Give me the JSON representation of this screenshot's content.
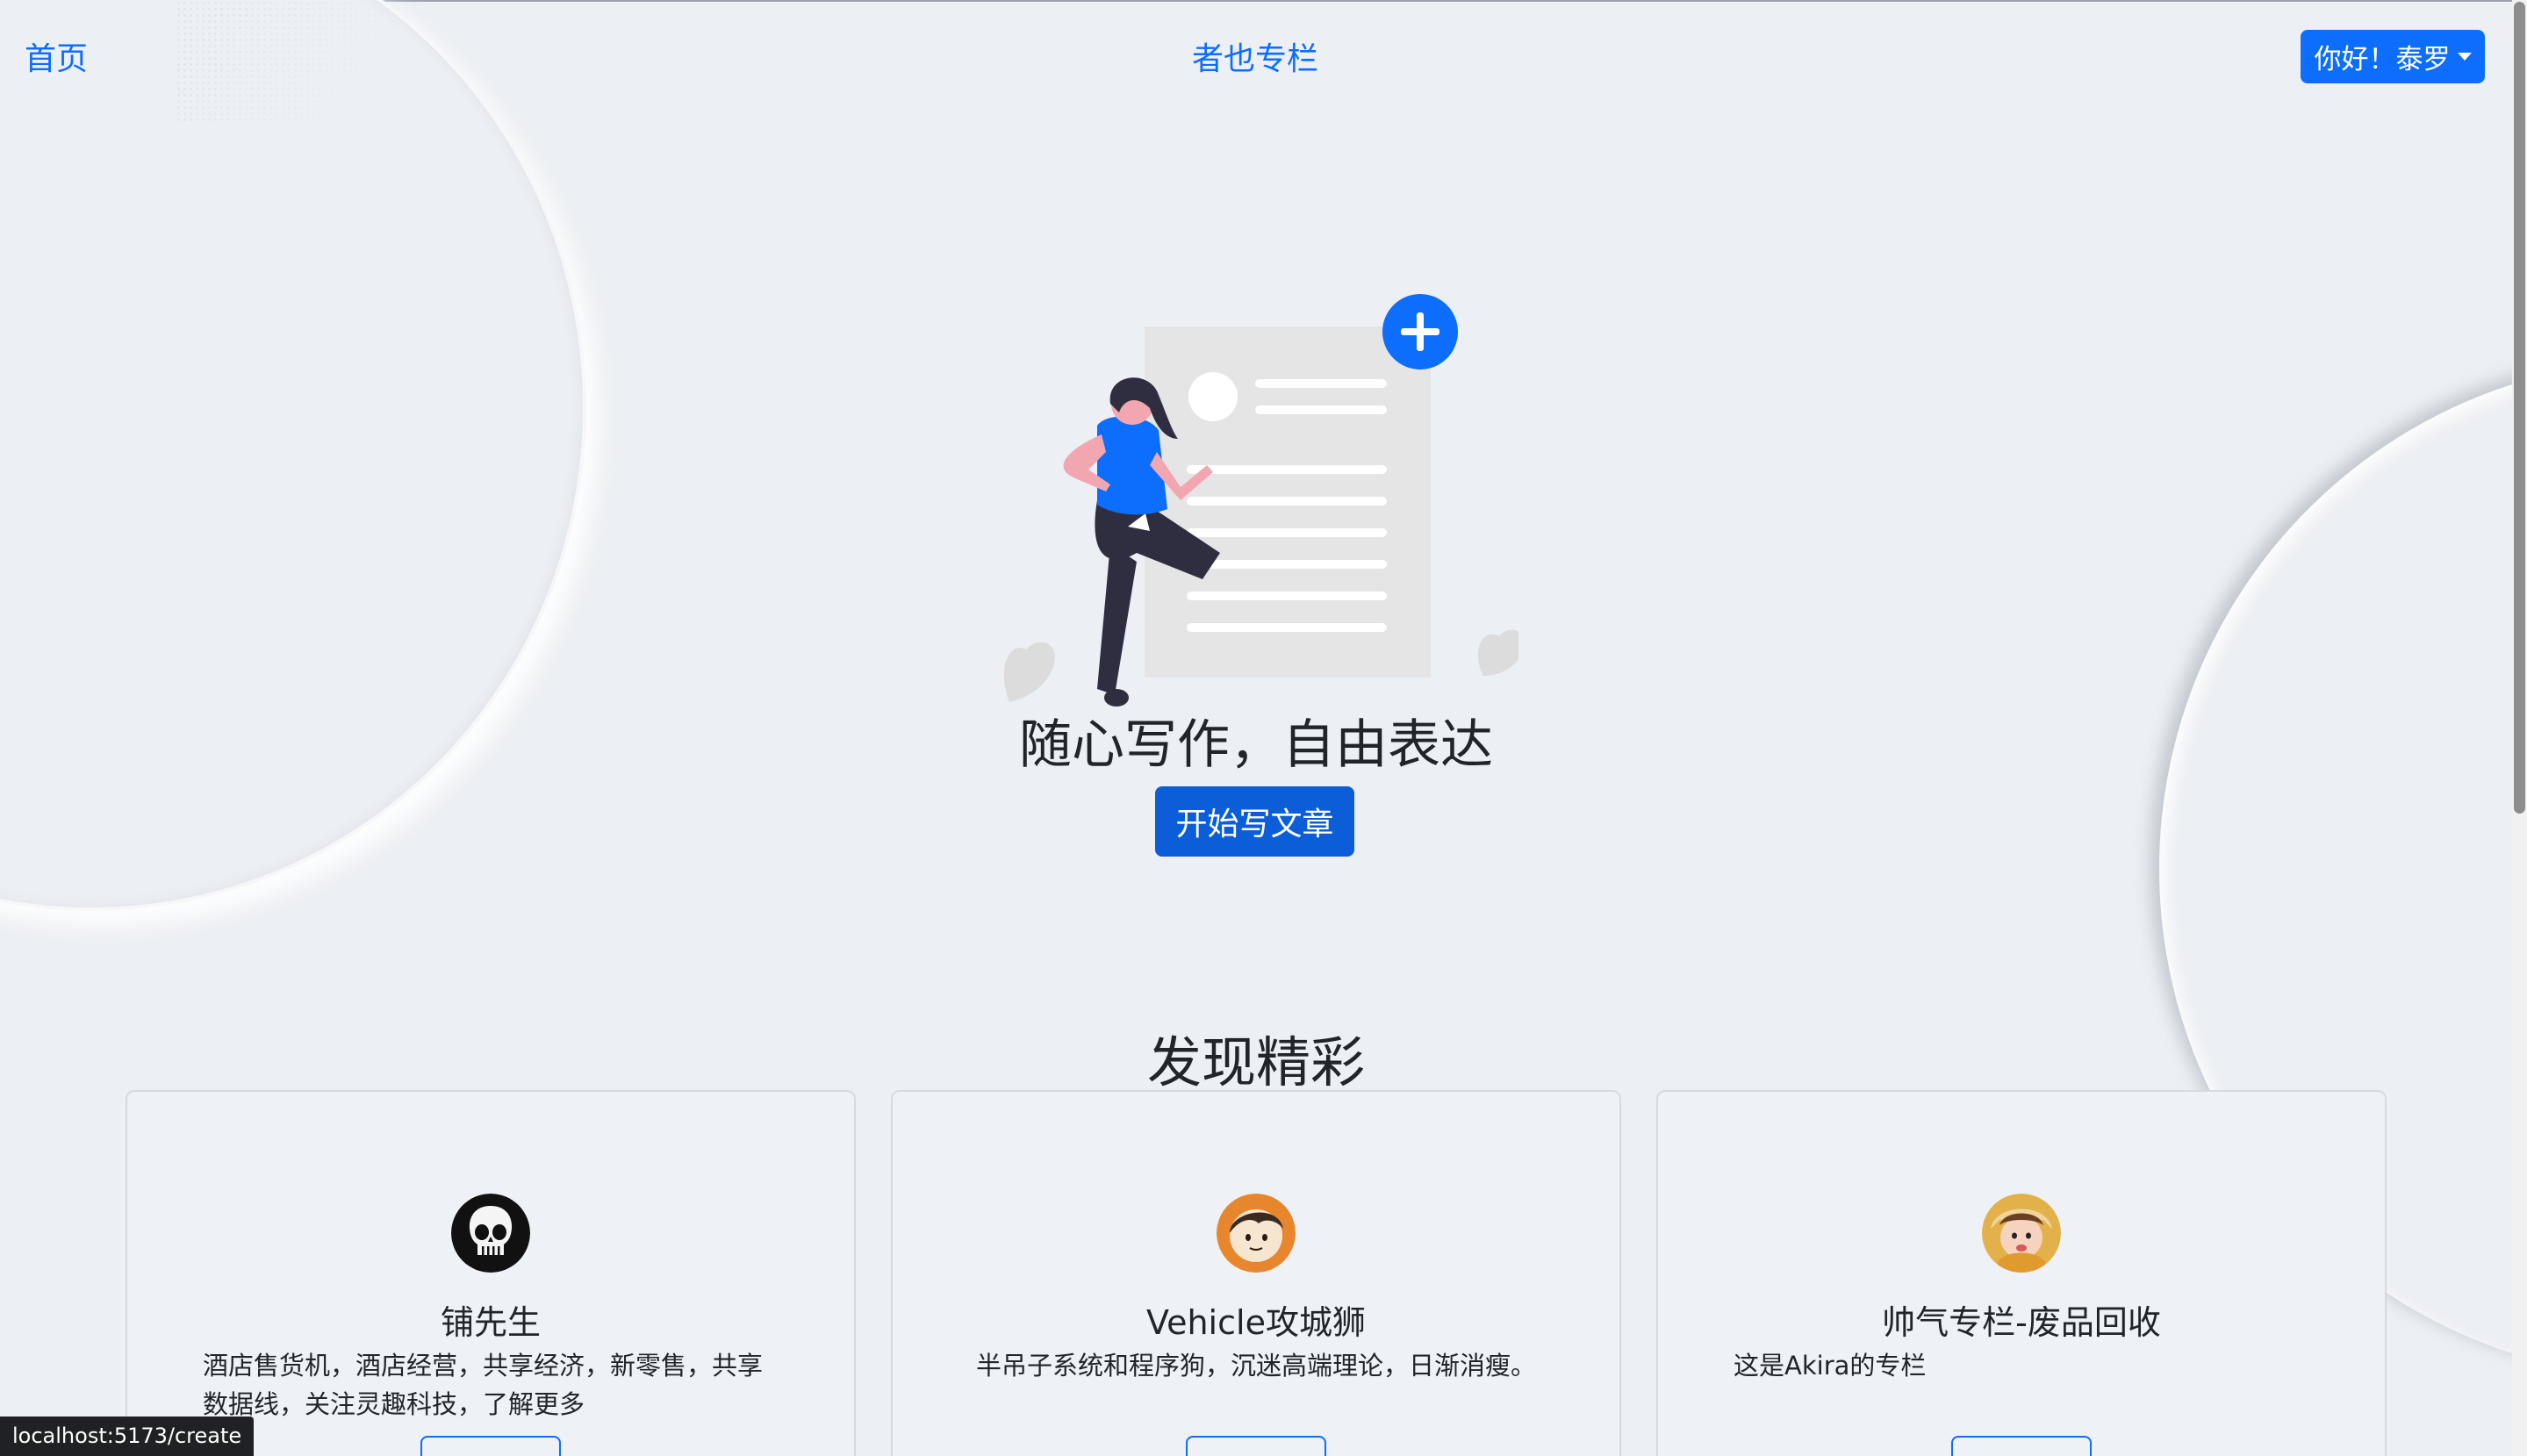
{
  "nav": {
    "home": "首页",
    "brand": "者也专栏",
    "user_greeting": "你好！泰罗"
  },
  "hero": {
    "title": "随心写作，自由表达",
    "button": "开始写文章"
  },
  "discover": {
    "title": "发现精彩",
    "columns": [
      {
        "name": "铺先生",
        "desc": "酒店售货机，酒店经营，共享经济，新零售，共享数据线，关注灵趣科技，了解更多",
        "avatar": "skull-avatar-icon"
      },
      {
        "name": "Vehicle攻城狮",
        "desc": "半吊子系统和程序狗，沉迷高端理论，日渐消瘦。",
        "avatar": "cartoon-face-avatar-icon"
      },
      {
        "name": "帅气专栏-废品回收",
        "desc": "这是Akira的专栏",
        "avatar": "child-photo-avatar-icon"
      }
    ]
  },
  "status_bar": {
    "url": "localhost:5173/create"
  },
  "colors": {
    "primary": "#0d6efd",
    "background": "#eceff3",
    "text": "#212529"
  }
}
